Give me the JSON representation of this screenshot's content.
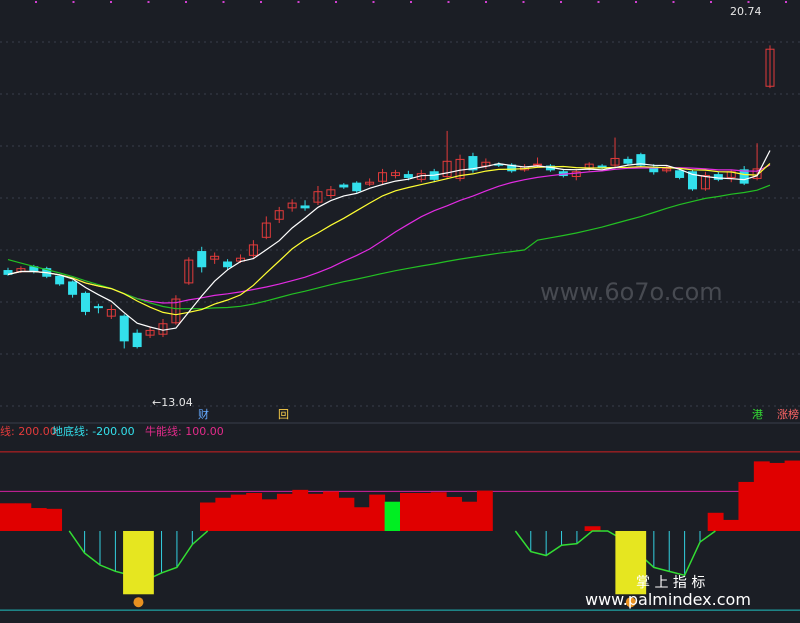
{
  "chart_data": [
    {
      "type": "candlestick",
      "panel": "price",
      "annotations": {
        "high_label": "20.74",
        "low_label": "←13.04",
        "marker_cai": "财",
        "marker_hui": "回",
        "marker_gang": "港",
        "marker_zhangting": "涨榜"
      },
      "watermark": "www.6o7o.com",
      "candles": [
        {
          "o": 15.62,
          "c": 15.54,
          "h": 15.68,
          "l": 15.51
        },
        {
          "o": 15.6,
          "c": 15.66,
          "h": 15.71,
          "l": 15.57
        },
        {
          "o": 15.7,
          "c": 15.6,
          "h": 15.74,
          "l": 15.56
        },
        {
          "o": 15.66,
          "c": 15.5,
          "h": 15.7,
          "l": 15.46
        },
        {
          "o": 15.5,
          "c": 15.34,
          "h": 15.54,
          "l": 15.3
        },
        {
          "o": 15.38,
          "c": 15.12,
          "h": 15.41,
          "l": 15.05
        },
        {
          "o": 15.14,
          "c": 14.76,
          "h": 15.18,
          "l": 14.68
        },
        {
          "o": 14.86,
          "c": 14.84,
          "h": 14.92,
          "l": 14.72
        },
        {
          "o": 14.66,
          "c": 14.8,
          "h": 14.9,
          "l": 14.6
        },
        {
          "o": 14.66,
          "c": 14.14,
          "h": 14.7,
          "l": 13.98
        },
        {
          "o": 14.3,
          "c": 14.02,
          "h": 14.38,
          "l": 13.98
        },
        {
          "o": 14.26,
          "c": 14.36,
          "h": 14.44,
          "l": 14.2
        },
        {
          "o": 14.28,
          "c": 14.5,
          "h": 14.6,
          "l": 14.22
        },
        {
          "o": 14.52,
          "c": 15.02,
          "h": 15.1,
          "l": 14.48
        },
        {
          "o": 15.36,
          "c": 15.84,
          "h": 15.9,
          "l": 15.32
        },
        {
          "o": 16.02,
          "c": 15.7,
          "h": 16.12,
          "l": 15.58
        },
        {
          "o": 15.86,
          "c": 15.92,
          "h": 16.0,
          "l": 15.76
        },
        {
          "o": 15.8,
          "c": 15.7,
          "h": 15.86,
          "l": 15.64
        },
        {
          "o": 15.82,
          "c": 15.88,
          "h": 15.96,
          "l": 15.78
        },
        {
          "o": 15.94,
          "c": 16.16,
          "h": 16.26,
          "l": 15.86
        },
        {
          "o": 16.32,
          "c": 16.62,
          "h": 16.76,
          "l": 16.28
        },
        {
          "o": 16.7,
          "c": 16.88,
          "h": 16.96,
          "l": 16.62
        },
        {
          "o": 16.94,
          "c": 17.04,
          "h": 17.12,
          "l": 16.86
        },
        {
          "o": 16.98,
          "c": 16.94,
          "h": 17.1,
          "l": 16.88
        },
        {
          "o": 17.06,
          "c": 17.28,
          "h": 17.4,
          "l": 17.0
        },
        {
          "o": 17.2,
          "c": 17.32,
          "h": 17.4,
          "l": 17.14
        },
        {
          "o": 17.42,
          "c": 17.38,
          "h": 17.46,
          "l": 17.34
        },
        {
          "o": 17.46,
          "c": 17.3,
          "h": 17.5,
          "l": 17.26
        },
        {
          "o": 17.44,
          "c": 17.48,
          "h": 17.56,
          "l": 17.4
        },
        {
          "o": 17.5,
          "c": 17.68,
          "h": 17.76,
          "l": 17.44
        },
        {
          "o": 17.62,
          "c": 17.68,
          "h": 17.74,
          "l": 17.56
        },
        {
          "o": 17.64,
          "c": 17.58,
          "h": 17.72,
          "l": 17.52
        },
        {
          "o": 17.54,
          "c": 17.66,
          "h": 17.74,
          "l": 17.48
        },
        {
          "o": 17.7,
          "c": 17.54,
          "h": 17.76,
          "l": 17.48
        },
        {
          "o": 17.6,
          "c": 17.92,
          "h": 18.56,
          "l": 17.56
        },
        {
          "o": 17.56,
          "c": 17.96,
          "h": 18.06,
          "l": 17.5
        },
        {
          "o": 18.02,
          "c": 17.74,
          "h": 18.1,
          "l": 17.68
        },
        {
          "o": 17.82,
          "c": 17.9,
          "h": 17.98,
          "l": 17.76
        },
        {
          "o": 17.86,
          "c": 17.84,
          "h": 17.9,
          "l": 17.8
        },
        {
          "o": 17.84,
          "c": 17.72,
          "h": 17.88,
          "l": 17.68
        },
        {
          "o": 17.74,
          "c": 17.8,
          "h": 17.86,
          "l": 17.7
        },
        {
          "o": 17.84,
          "c": 17.86,
          "h": 18.0,
          "l": 17.8
        },
        {
          "o": 17.82,
          "c": 17.74,
          "h": 17.86,
          "l": 17.7
        },
        {
          "o": 17.7,
          "c": 17.62,
          "h": 17.76,
          "l": 17.58
        },
        {
          "o": 17.6,
          "c": 17.7,
          "h": 17.76,
          "l": 17.52
        },
        {
          "o": 17.76,
          "c": 17.86,
          "h": 17.9,
          "l": 17.72
        },
        {
          "o": 17.82,
          "c": 17.78,
          "h": 17.86,
          "l": 17.76
        },
        {
          "o": 17.84,
          "c": 17.98,
          "h": 18.42,
          "l": 17.8
        },
        {
          "o": 17.96,
          "c": 17.88,
          "h": 18.02,
          "l": 17.84
        },
        {
          "o": 18.06,
          "c": 17.84,
          "h": 18.1,
          "l": 17.8
        },
        {
          "o": 17.8,
          "c": 17.7,
          "h": 17.86,
          "l": 17.64
        },
        {
          "o": 17.72,
          "c": 17.76,
          "h": 17.82,
          "l": 17.68
        },
        {
          "o": 17.72,
          "c": 17.58,
          "h": 17.76,
          "l": 17.54
        },
        {
          "o": 17.7,
          "c": 17.34,
          "h": 17.74,
          "l": 17.3
        },
        {
          "o": 17.34,
          "c": 17.62,
          "h": 17.7,
          "l": 17.3
        },
        {
          "o": 17.64,
          "c": 17.54,
          "h": 17.7,
          "l": 17.5
        },
        {
          "o": 17.58,
          "c": 17.7,
          "h": 17.74,
          "l": 17.48
        },
        {
          "o": 17.74,
          "c": 17.46,
          "h": 17.82,
          "l": 17.42
        },
        {
          "o": 17.56,
          "c": 17.76,
          "h": 18.3,
          "l": 17.52
        },
        {
          "o": 19.5,
          "c": 20.28,
          "h": 20.36,
          "l": 19.46
        }
      ]
    },
    {
      "type": "bar",
      "panel": "indicator",
      "legend": {
        "prefix": "线: 200.00",
        "series2": "地底线: -200.00",
        "series3": "牛能线: 100.00"
      },
      "reference_lines": [
        200,
        100,
        -200
      ],
      "ylim": [
        -225,
        230
      ],
      "bars": [
        70,
        70,
        58,
        56,
        0,
        -56,
        -86,
        -102,
        -112,
        -124,
        -106,
        -92,
        -34,
        72,
        84,
        92,
        96,
        80,
        94,
        104,
        94,
        100,
        84,
        60,
        92,
        74,
        96,
        96,
        98,
        86,
        74,
        102,
        0,
        0,
        -52,
        -62,
        -36,
        -32,
        12,
        0,
        -22,
        -56,
        -92,
        -102,
        -112,
        -28,
        46,
        28,
        124,
        176,
        172,
        178
      ],
      "green_bar_index": 25,
      "yellow_bar_indices": [
        8,
        9,
        40,
        41
      ],
      "ticks_text": {
        "left": "掌 上 指 标",
        "bottom": "www.palmindex.com"
      }
    }
  ],
  "colors": {
    "up": "#e23b3b",
    "down": "#33e0ec",
    "ma5": "#ffffff",
    "ma10": "#ffff33",
    "ma20": "#e22be2",
    "ma60": "#23c023",
    "bar": "#e00000",
    "greenbar": "#00ee22",
    "yellowbar": "#e6e620"
  }
}
